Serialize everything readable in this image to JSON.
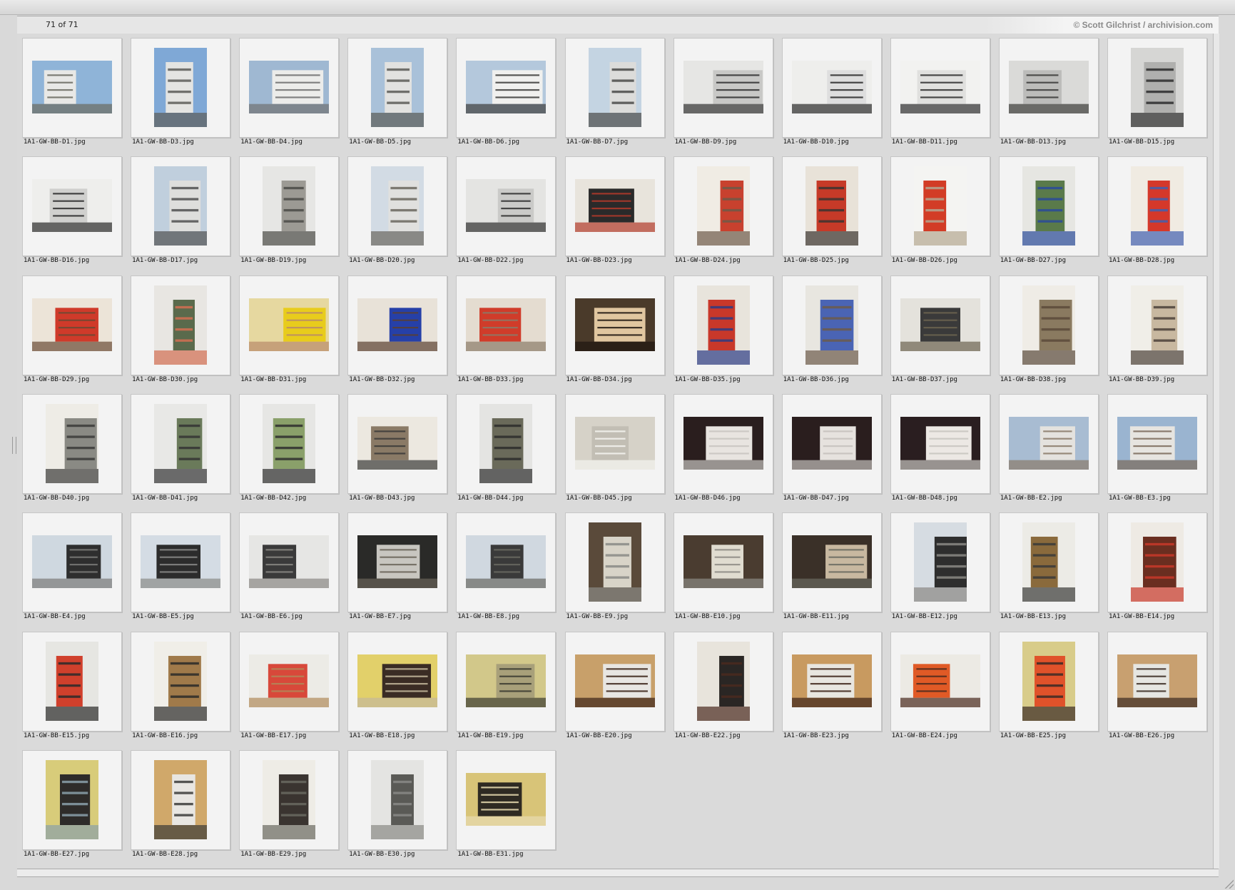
{
  "header": {
    "counter": "71 of 71",
    "copyright": "© Scott Gilchrist / archivision.com"
  },
  "thumbnails": [
    {
      "filename": "1A1-GW-BB-D1.jpg",
      "orientation": "landscape",
      "palette": [
        "#8fb4d8",
        "#e8e8e6",
        "#6a6a60"
      ]
    },
    {
      "filename": "1A1-GW-BB-D3.jpg",
      "orientation": "portrait",
      "palette": [
        "#7fa8d6",
        "#e4e4e2",
        "#5c5c58"
      ]
    },
    {
      "filename": "1A1-GW-BB-D4.jpg",
      "orientation": "landscape",
      "palette": [
        "#9fb8d2",
        "#ececea",
        "#707070"
      ]
    },
    {
      "filename": "1A1-GW-BB-D5.jpg",
      "orientation": "portrait",
      "palette": [
        "#a9c1d9",
        "#e2e2e0",
        "#5a5a56"
      ]
    },
    {
      "filename": "1A1-GW-BB-D6.jpg",
      "orientation": "landscape",
      "palette": [
        "#b4c8dc",
        "#f0f0ee",
        "#3c3c3a"
      ]
    },
    {
      "filename": "1A1-GW-BB-D7.jpg",
      "orientation": "portrait",
      "palette": [
        "#c4d4e2",
        "#dcdcda",
        "#4a4a48"
      ]
    },
    {
      "filename": "1A1-GW-BB-D9.jpg",
      "orientation": "landscape",
      "palette": [
        "#e6e6e4",
        "#c8c8c6",
        "#303030"
      ]
    },
    {
      "filename": "1A1-GW-BB-D10.jpg",
      "orientation": "landscape",
      "palette": [
        "#eeeeec",
        "#dedede",
        "#2a2a2a"
      ]
    },
    {
      "filename": "1A1-GW-BB-D11.jpg",
      "orientation": "landscape",
      "palette": [
        "#f2f2f0",
        "#e0e0de",
        "#2e2e2e"
      ]
    },
    {
      "filename": "1A1-GW-BB-D13.jpg",
      "orientation": "landscape",
      "palette": [
        "#dadad8",
        "#bcbcba",
        "#3a3a38"
      ]
    },
    {
      "filename": "1A1-GW-BB-D15.jpg",
      "orientation": "portrait",
      "palette": [
        "#d6d6d4",
        "#b0b0ae",
        "#2c2c2c"
      ]
    },
    {
      "filename": "1A1-GW-BB-D16.jpg",
      "orientation": "landscape",
      "palette": [
        "#eeeeec",
        "#d0d0ce",
        "#2a2a2a"
      ]
    },
    {
      "filename": "1A1-GW-BB-D17.jpg",
      "orientation": "portrait",
      "palette": [
        "#c0cfdd",
        "#dededc",
        "#505050"
      ]
    },
    {
      "filename": "1A1-GW-BB-D19.jpg",
      "orientation": "portrait",
      "palette": [
        "#e6e6e4",
        "#9c9a94",
        "#4a4a46"
      ]
    },
    {
      "filename": "1A1-GW-BB-D20.jpg",
      "orientation": "portrait",
      "palette": [
        "#d2dbe4",
        "#e0e0de",
        "#6a665e"
      ]
    },
    {
      "filename": "1A1-GW-BB-D22.jpg",
      "orientation": "landscape",
      "palette": [
        "#e4e4e2",
        "#cacac8",
        "#2e2e2e"
      ]
    },
    {
      "filename": "1A1-GW-BB-D23.jpg",
      "orientation": "landscape",
      "palette": [
        "#e8e4dc",
        "#2a2a2a",
        "#b23a2a"
      ]
    },
    {
      "filename": "1A1-GW-BB-D24.jpg",
      "orientation": "portrait",
      "palette": [
        "#f0ece4",
        "#c8412e",
        "#6c5a48"
      ]
    },
    {
      "filename": "1A1-GW-BB-D25.jpg",
      "orientation": "portrait",
      "palette": [
        "#e8e2d8",
        "#c63a28",
        "#3a3430"
      ]
    },
    {
      "filename": "1A1-GW-BB-D26.jpg",
      "orientation": "portrait",
      "palette": [
        "#f4f4f2",
        "#d23c26",
        "#b4a690"
      ]
    },
    {
      "filename": "1A1-GW-BB-D27.jpg",
      "orientation": "portrait",
      "palette": [
        "#e6e6e2",
        "#5a7a4a",
        "#2a4a9a"
      ]
    },
    {
      "filename": "1A1-GW-BB-D28.jpg",
      "orientation": "portrait",
      "palette": [
        "#f0ebe2",
        "#d5382a",
        "#4060b0"
      ]
    },
    {
      "filename": "1A1-GW-BB-D29.jpg",
      "orientation": "landscape",
      "palette": [
        "#ece4d8",
        "#cf3a2a",
        "#6a4a34"
      ]
    },
    {
      "filename": "1A1-GW-BB-D30.jpg",
      "orientation": "portrait",
      "palette": [
        "#e8e6e2",
        "#5a6a4c",
        "#d36e52"
      ]
    },
    {
      "filename": "1A1-GW-BB-D31.jpg",
      "orientation": "landscape",
      "palette": [
        "#e6d8a0",
        "#e8cc1c",
        "#b88a6a"
      ]
    },
    {
      "filename": "1A1-GW-BB-D32.jpg",
      "orientation": "landscape",
      "palette": [
        "#e8e2d8",
        "#2640a8",
        "#5a4030"
      ]
    },
    {
      "filename": "1A1-GW-BB-D33.jpg",
      "orientation": "landscape",
      "palette": [
        "#e4dcd0",
        "#d03c2a",
        "#8a7a68"
      ]
    },
    {
      "filename": "1A1-GW-BB-D34.jpg",
      "orientation": "landscape",
      "palette": [
        "#4a3a2a",
        "#e0c6a0",
        "#1e1610"
      ]
    },
    {
      "filename": "1A1-GW-BB-D35.jpg",
      "orientation": "portrait",
      "palette": [
        "#e8e4dc",
        "#c8382a",
        "#2c3c84"
      ]
    },
    {
      "filename": "1A1-GW-BB-D36.jpg",
      "orientation": "portrait",
      "palette": [
        "#e8e6e0",
        "#4a64b4",
        "#6c5a4a"
      ]
    },
    {
      "filename": "1A1-GW-BB-D37.jpg",
      "orientation": "landscape",
      "palette": [
        "#e4e2dc",
        "#3a3a3a",
        "#6c6450"
      ]
    },
    {
      "filename": "1A1-GW-BB-D38.jpg",
      "orientation": "portrait",
      "palette": [
        "#efece6",
        "#8a7a60",
        "#5a4a3a"
      ]
    },
    {
      "filename": "1A1-GW-BB-D39.jpg",
      "orientation": "portrait",
      "palette": [
        "#f0eee8",
        "#c8b8a0",
        "#4a4038"
      ]
    },
    {
      "filename": "1A1-GW-BB-D40.jpg",
      "orientation": "portrait",
      "palette": [
        "#eeece6",
        "#8a8a84",
        "#3a3a38"
      ]
    },
    {
      "filename": "1A1-GW-BB-D41.jpg",
      "orientation": "portrait",
      "palette": [
        "#e8e8e6",
        "#6a7a5a",
        "#343434"
      ]
    },
    {
      "filename": "1A1-GW-BB-D42.jpg",
      "orientation": "portrait",
      "palette": [
        "#e6e6e4",
        "#8aa06a",
        "#2e2e2e"
      ]
    },
    {
      "filename": "1A1-GW-BB-D43.jpg",
      "orientation": "landscape",
      "palette": [
        "#ece8e0",
        "#8a7a66",
        "#3a3a38"
      ]
    },
    {
      "filename": "1A1-GW-BB-D44.jpg",
      "orientation": "portrait",
      "palette": [
        "#e4e4e2",
        "#6a6a5a",
        "#2c2c2c"
      ]
    },
    {
      "filename": "1A1-GW-BB-D45.jpg",
      "orientation": "landscape",
      "palette": [
        "#d6d2c8",
        "#c2beb4",
        "#f4f4f0"
      ]
    },
    {
      "filename": "1A1-GW-BB-D46.jpg",
      "orientation": "landscape",
      "palette": [
        "#2a1e1e",
        "#e8e4e0",
        "#c8c4c0"
      ]
    },
    {
      "filename": "1A1-GW-BB-D47.jpg",
      "orientation": "landscape",
      "palette": [
        "#2a1e1e",
        "#e6e2de",
        "#c4c0bc"
      ]
    },
    {
      "filename": "1A1-GW-BB-D48.jpg",
      "orientation": "landscape",
      "palette": [
        "#2a1e20",
        "#ece8e4",
        "#c8c4c0"
      ]
    },
    {
      "filename": "1A1-GW-BB-E2.jpg",
      "orientation": "landscape",
      "palette": [
        "#a8bcd2",
        "#e4e2de",
        "#8a7a6a"
      ]
    },
    {
      "filename": "1A1-GW-BB-E3.jpg",
      "orientation": "landscape",
      "palette": [
        "#9ab4d0",
        "#e6e4e0",
        "#7a6a5a"
      ]
    },
    {
      "filename": "1A1-GW-BB-E4.jpg",
      "orientation": "landscape",
      "palette": [
        "#cfd8e0",
        "#2e2e2e",
        "#7a7a78"
      ]
    },
    {
      "filename": "1A1-GW-BB-E5.jpg",
      "orientation": "landscape",
      "palette": [
        "#d4dce4",
        "#2c2c2c",
        "#8a8a88"
      ]
    },
    {
      "filename": "1A1-GW-BB-E6.jpg",
      "orientation": "landscape",
      "palette": [
        "#e6e6e4",
        "#3a3a3a",
        "#8a8884"
      ]
    },
    {
      "filename": "1A1-GW-BB-E7.jpg",
      "orientation": "landscape",
      "palette": [
        "#2a2a28",
        "#c8c6c0",
        "#6a6458"
      ]
    },
    {
      "filename": "1A1-GW-BB-E8.jpg",
      "orientation": "landscape",
      "palette": [
        "#d0d8e0",
        "#3a3a3a",
        "#6a6a62"
      ]
    },
    {
      "filename": "1A1-GW-BB-E9.jpg",
      "orientation": "portrait",
      "palette": [
        "#5a4a3a",
        "#d8d4c8",
        "#8a8a86"
      ]
    },
    {
      "filename": "1A1-GW-BB-E10.jpg",
      "orientation": "landscape",
      "palette": [
        "#4a3c30",
        "#e0dcd0",
        "#8c8a84"
      ]
    },
    {
      "filename": "1A1-GW-BB-E11.jpg",
      "orientation": "landscape",
      "palette": [
        "#3a3028",
        "#c8b8a0",
        "#6a6a60"
      ]
    },
    {
      "filename": "1A1-GW-BB-E12.jpg",
      "orientation": "portrait",
      "palette": [
        "#d6dce2",
        "#2e2e2e",
        "#8a8884"
      ]
    },
    {
      "filename": "1A1-GW-BB-E13.jpg",
      "orientation": "portrait",
      "palette": [
        "#ecebe6",
        "#8a6a3c",
        "#3a3a38"
      ]
    },
    {
      "filename": "1A1-GW-BB-E14.jpg",
      "orientation": "portrait",
      "palette": [
        "#eeeae4",
        "#6a2e20",
        "#c8382a"
      ]
    },
    {
      "filename": "1A1-GW-BB-E15.jpg",
      "orientation": "portrait",
      "palette": [
        "#e6e6e2",
        "#d0402c",
        "#2a2a2a"
      ]
    },
    {
      "filename": "1A1-GW-BB-E16.jpg",
      "orientation": "portrait",
      "palette": [
        "#f0eee8",
        "#a07a4a",
        "#2a2a28"
      ]
    },
    {
      "filename": "1A1-GW-BB-E17.jpg",
      "orientation": "landscape",
      "palette": [
        "#ecebe6",
        "#d8483a",
        "#b08a5a"
      ]
    },
    {
      "filename": "1A1-GW-BB-E18.jpg",
      "orientation": "landscape",
      "palette": [
        "#e2d06a",
        "#3a2c24",
        "#c4b89c"
      ]
    },
    {
      "filename": "1A1-GW-BB-E19.jpg",
      "orientation": "landscape",
      "palette": [
        "#d2c88a",
        "#a8a07a",
        "#3a3a30"
      ]
    },
    {
      "filename": "1A1-GW-BB-E20.jpg",
      "orientation": "landscape",
      "palette": [
        "#c8a06a",
        "#e8e6e2",
        "#3a2218"
      ]
    },
    {
      "filename": "1A1-GW-BB-E22.jpg",
      "orientation": "portrait",
      "palette": [
        "#e8e4dc",
        "#2a2624",
        "#4a2a1e"
      ]
    },
    {
      "filename": "1A1-GW-BB-E23.jpg",
      "orientation": "landscape",
      "palette": [
        "#c89a60",
        "#e8e6e0",
        "#3c2218"
      ]
    },
    {
      "filename": "1A1-GW-BB-E24.jpg",
      "orientation": "landscape",
      "palette": [
        "#eceae4",
        "#e05a26",
        "#4a2a1e"
      ]
    },
    {
      "filename": "1A1-GW-BB-E25.jpg",
      "orientation": "portrait",
      "palette": [
        "#d8cc8a",
        "#e0522a",
        "#3a2a24"
      ]
    },
    {
      "filename": "1A1-GW-BB-E26.jpg",
      "orientation": "landscape",
      "palette": [
        "#c8a070",
        "#e6e6e2",
        "#3a2a22"
      ]
    },
    {
      "filename": "1A1-GW-BB-E27.jpg",
      "orientation": "portrait",
      "palette": [
        "#d8cc7a",
        "#2e2c2a",
        "#8aa0aa"
      ]
    },
    {
      "filename": "1A1-GW-BB-E28.jpg",
      "orientation": "portrait",
      "palette": [
        "#d0a86a",
        "#e8e6e2",
        "#3a3a38"
      ]
    },
    {
      "filename": "1A1-GW-BB-E29.jpg",
      "orientation": "portrait",
      "palette": [
        "#eeece6",
        "#3a3430",
        "#6a6a60"
      ]
    },
    {
      "filename": "1A1-GW-BB-E30.jpg",
      "orientation": "portrait",
      "palette": [
        "#e4e4e2",
        "#5a5a56",
        "#8a8a86"
      ]
    },
    {
      "filename": "1A1-GW-BB-E31.jpg",
      "orientation": "landscape",
      "palette": [
        "#d8c478",
        "#2e2a22",
        "#e8dcb0"
      ]
    }
  ]
}
